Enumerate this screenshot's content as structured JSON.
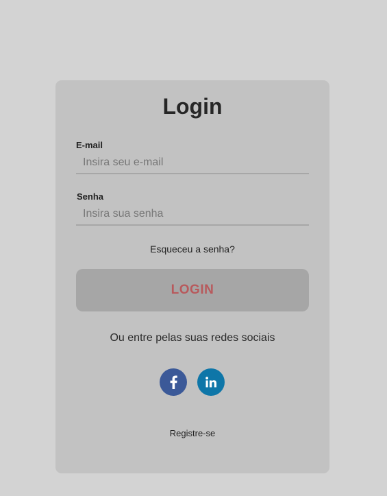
{
  "login_form": {
    "title": "Login",
    "email": {
      "label": "E-mail",
      "value": "",
      "placeholder": "Insira seu e-mail"
    },
    "password": {
      "label": "Senha",
      "value": "",
      "placeholder": "Insira sua senha"
    },
    "forgot_password_link": "Esqueceu a senha?",
    "login_button": "LOGIN",
    "social_prompt": "Ou entre pelas suas redes sociais",
    "social_buttons": [
      {
        "icon": "facebook-icon",
        "color": "#3b5998"
      },
      {
        "icon": "linkedin-icon",
        "color": "#0e76a8"
      }
    ],
    "register_link": "Registre-se"
  },
  "colors": {
    "page_background": "#d3d3d3",
    "card_background": "#c2c2c2",
    "button_background": "#a6a6a6",
    "button_text": "#b8595c"
  }
}
